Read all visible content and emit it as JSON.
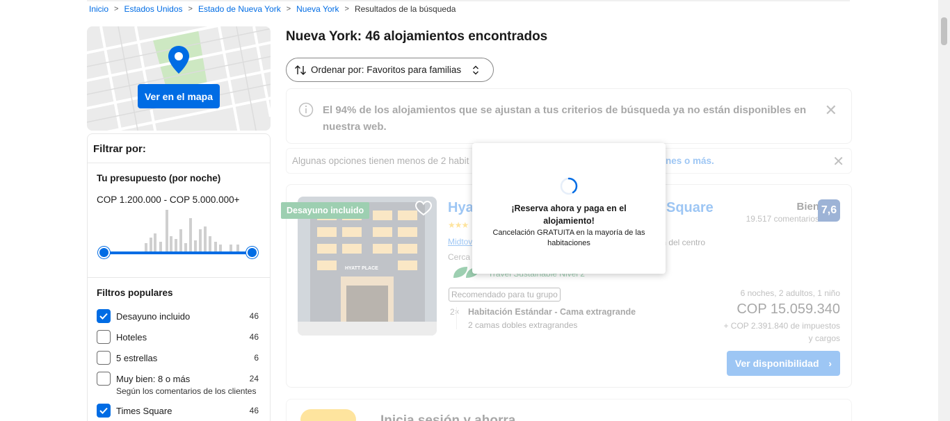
{
  "breadcrumb": {
    "items": [
      "Inicio",
      "Estados Unidos",
      "Estado de Nueva York",
      "Nueva York"
    ],
    "current": "Resultados de la búsqueda"
  },
  "map": {
    "button_label": "Ver en el mapa"
  },
  "filters": {
    "title": "Filtrar por:",
    "budget": {
      "heading": "Tu presupuesto (por noche)",
      "range": "COP 1.200.000 - COP 5.000.000+",
      "low": 0,
      "high": 1
    },
    "popular": {
      "heading": "Filtros populares",
      "items": [
        {
          "label": "Desayuno incluido",
          "count": "46",
          "checked": true
        },
        {
          "label": "Hoteles",
          "count": "46",
          "checked": false
        },
        {
          "label": "5 estrellas",
          "count": "6",
          "checked": false
        },
        {
          "label": "Muy bien: 8 o más",
          "count": "24",
          "checked": false,
          "sub": "Según los comentarios de los clientes"
        },
        {
          "label": "Times Square",
          "count": "46",
          "checked": true
        }
      ]
    }
  },
  "results": {
    "title": "Nueva York: 46 alojamientos encontrados",
    "sort_label": "Ordenar por: Favoritos para familias"
  },
  "notice": {
    "text": "El 94% de los alojamientos que se ajustan a tus criterios de búsqueda ya no están disponibles en nuestra web."
  },
  "minor_notice": {
    "text": "Algunas opciones tienen menos de 2 habit",
    "link": "nes o más."
  },
  "property": {
    "ribbon": "Desayuno incluido",
    "name_start": "Hya",
    "name_end": "Square",
    "stars": "★★★",
    "location": "Midtov",
    "location_tail": "m del centro",
    "near": "Cerca d",
    "sustainable": "Travel Sustainable Nivel 2",
    "recommended": "Recomendado para tu grupo",
    "qty": "2×",
    "room": "Habitación Estándar - Cama extragrande",
    "beds": "2 camas dobles extragrandes",
    "score_label": "Bien",
    "reviews": "19.517 comentarios",
    "score": "7,6",
    "nights": "6 noches, 2 adultos, 1 niño",
    "price": "COP 15.059.340",
    "taxes_1": "+ COP 2.391.840 de impuestos",
    "taxes_2": "y cargos",
    "cta": "Ver disponibilidad",
    "photo_sign": "HYATT PLACE"
  },
  "next_card": {
    "text": "Inicia sesión y ahorra"
  },
  "modal": {
    "heading": "¡Reserva ahora y paga en el alojamiento!",
    "sub": "Cancelación GRATUITA en la mayoría de las habitaciones"
  },
  "colors": {
    "brand_blue": "#006ce4",
    "score_blue": "#003b95",
    "green": "#008234",
    "yellow": "#febb02"
  }
}
